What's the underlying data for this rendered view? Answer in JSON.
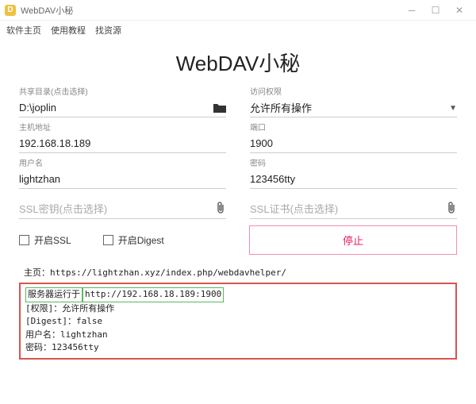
{
  "window": {
    "title": "WebDAV小秘"
  },
  "menu": {
    "home": "软件主页",
    "tutorial": "使用教程",
    "resources": "找资源"
  },
  "page": {
    "title": "WebDAV小秘"
  },
  "fields": {
    "share_dir": {
      "label": "共享目录(点击选择)",
      "value": "D:\\joplin"
    },
    "access": {
      "label": "访问权限",
      "value": "允许所有操作"
    },
    "host": {
      "label": "主机地址",
      "value": "192.168.18.189"
    },
    "port": {
      "label": "端口",
      "value": "1900"
    },
    "user": {
      "label": "用户名",
      "value": "lightzhan"
    },
    "password": {
      "label": "密码",
      "value": "123456tty"
    },
    "ssl_key": {
      "placeholder": "SSL密钥(点击选择)"
    },
    "ssl_cert": {
      "placeholder": "SSL证书(点击选择)"
    }
  },
  "checks": {
    "ssl": "开启SSL",
    "digest": "开启Digest"
  },
  "buttons": {
    "stop": "停止"
  },
  "log": {
    "homepage_label": "主页：",
    "homepage_url": "https://lightzhan.xyz/index.php/webdavhelper/",
    "line1_a": "服务器运行于 ",
    "line1_b": "http://192.168.18.189:1900",
    "line2": "[权限]：允许所有操作",
    "line3": "[Digest]：false",
    "line4": "用户名：lightzhan",
    "line5": "密码：123456tty"
  }
}
